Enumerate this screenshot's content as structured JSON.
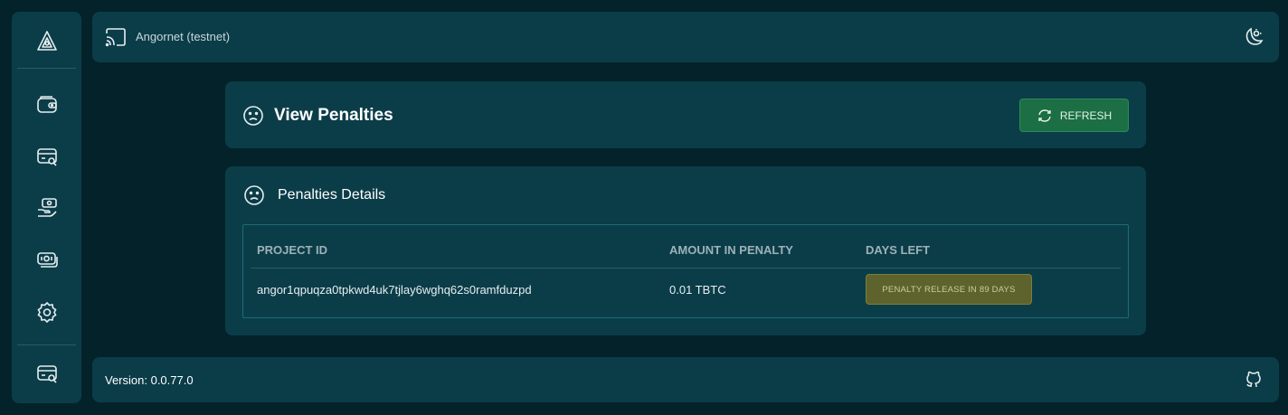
{
  "topbar": {
    "network_label": "Angornet (testnet)",
    "network_icon": "cast-icon",
    "theme_icon": "moon-sun-icon"
  },
  "sidebar": {
    "logo_icon": "angor-logo-icon",
    "items": [
      {
        "icon": "wallet-icon"
      },
      {
        "icon": "browse-card-search-icon"
      },
      {
        "icon": "hand-money-icon"
      },
      {
        "icon": "cash-stack-icon"
      },
      {
        "icon": "settings-icon"
      }
    ],
    "bottom_icon": "card-search-icon"
  },
  "header_card": {
    "title": "View Penalties",
    "refresh_label": "REFRESH"
  },
  "details_card": {
    "title": "Penalties Details",
    "columns": [
      "PROJECT ID",
      "AMOUNT IN PENALTY",
      "DAYS LEFT"
    ],
    "rows": [
      {
        "project_id": "angor1qpuqza0tpkwd4uk7tjlay6wghq62s0ramfduzpd",
        "amount": "0.01 TBTC",
        "days_left": "PENALTY RELEASE IN 89 DAYS"
      }
    ]
  },
  "footer": {
    "version": "Version: 0.0.77.0",
    "github_icon": "github-icon"
  },
  "colors": {
    "background": "#032229",
    "panel": "#0b3d49",
    "accent_green": "#1c6e44",
    "badge_olive": "#5e632d",
    "table_border": "#1d6b78"
  }
}
